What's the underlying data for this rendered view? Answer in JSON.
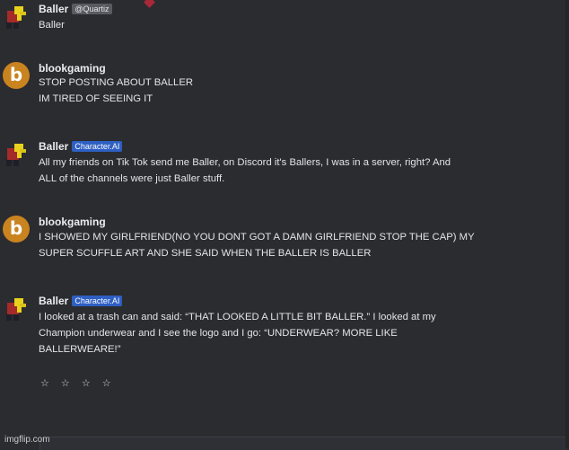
{
  "messages": [
    {
      "name": "Baller",
      "tag": "@Quartiz",
      "tag_style": "gray",
      "lines": [
        "Baller"
      ]
    },
    {
      "name": "blookgaming",
      "avatar_letter": "b",
      "lines": [
        "STOP POSTING ABOUT BALLER",
        "IM TIRED OF SEEING IT"
      ]
    },
    {
      "name": "Baller",
      "tag": "Character.AI",
      "tag_style": "blue",
      "lines": [
        "All my friends on Tik Tok send me Baller, on Discord it's Ballers, I was in a server, right? And",
        "ALL of the channels were just Baller stuff."
      ]
    },
    {
      "name": "blookgaming",
      "avatar_letter": "b",
      "lines": [
        "I SHOWED MY GIRLFRIEND(NO YOU DONT GOT A DAMN GIRLFRIEND STOP THE CAP) MY",
        "SUPER SCUFFLE ART AND SHE SAID WHEN THE BALLER IS BALLER"
      ]
    },
    {
      "name": "Baller",
      "tag": "Character.AI",
      "tag_style": "blue",
      "lines": [
        "I looked at a trash can and said: “THAT LOOKED A LITTLE BIT BALLER.” I looked at my",
        "Champion underwear and I see the logo and I go: “UNDERWEAR? MORE LIKE",
        "BALLERWEARE!”"
      ]
    }
  ],
  "rating": "☆ ☆ ☆ ☆",
  "watermark": "imgflip.com",
  "colors": {
    "background": "#2b2c30",
    "blue_tag": "#2e5fc3",
    "gray_tag": "#5a5b61",
    "avatar_b": "#c9831f"
  }
}
